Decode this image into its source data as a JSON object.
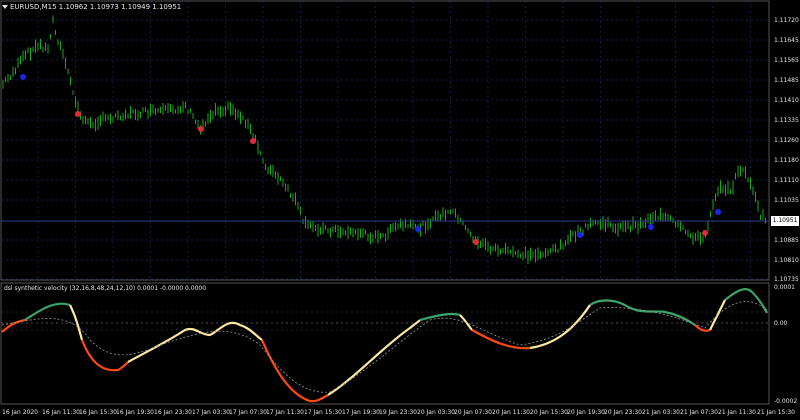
{
  "window": {
    "symbol_title": "EURUSD,M15  1.10962 1.10973 1.10949 1.10951"
  },
  "price_panel": {
    "y_ticks": [
      "1.11720",
      "1.11645",
      "1.11565",
      "1.11485",
      "1.11410",
      "1.11335",
      "1.11260",
      "1.11180",
      "1.11110",
      "1.11035",
      "1.10885",
      "1.10810",
      "1.10735"
    ],
    "current_price": "1.10951",
    "colors": {
      "candle": "#1fa51f",
      "buy_marker": "#1428e6",
      "sell_marker": "#e02a3a",
      "grid": "#1a2a66"
    }
  },
  "indicator_panel": {
    "title": "dsl synthetic velocity (32,16,8,48,24,12,10) 0.0001 -0.0000 0.0000",
    "y_ticks": [
      "0.0001",
      "0.00",
      "-0.0002"
    ],
    "colors": {
      "up": "#3aa66a",
      "neutral": "#ffe8a0",
      "down": "#ff4a12",
      "signal": "#9a9a9a"
    }
  },
  "time_axis": {
    "labels": [
      "16 Jan 2020",
      "16 Jan 11:30",
      "16 Jan 15:30",
      "16 Jan 19:30",
      "16 Jan 23:30",
      "17 Jan 03:30",
      "17 Jan 07:30",
      "17 Jan 11:30",
      "17 Jan 15:30",
      "17 Jan 19:30",
      "19 Jan 23:30",
      "20 Jan 03:30",
      "20 Jan 07:30",
      "20 Jan 11:30",
      "20 Jan 15:30",
      "20 Jan 19:30",
      "20 Jan 23:30",
      "21 Jan 03:30",
      "21 Jan 07:30",
      "21 Jan 11:30",
      "21 Jan 15:30"
    ]
  }
}
